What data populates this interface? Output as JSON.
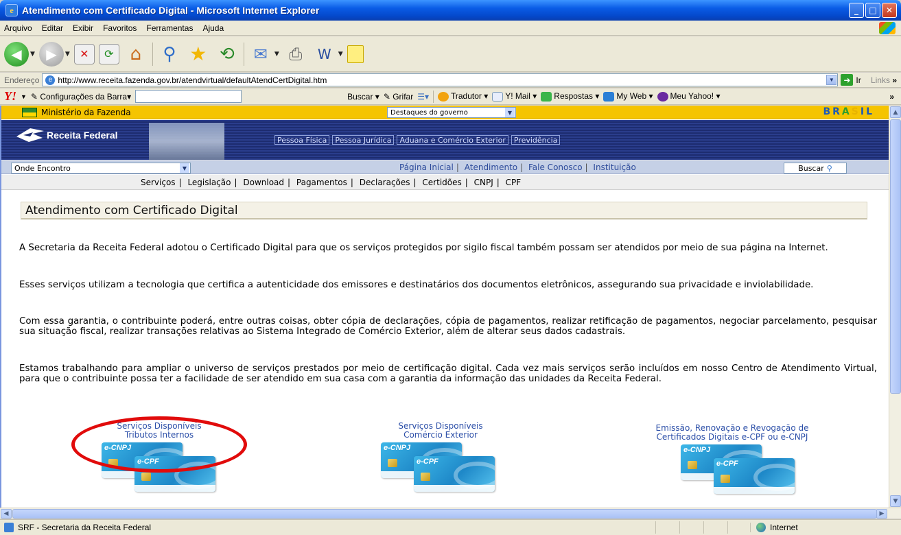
{
  "window": {
    "title": "Atendimento com Certificado Digital - Microsoft Internet Explorer",
    "icon": "ie-icon"
  },
  "menu": [
    "Arquivo",
    "Editar",
    "Exibir",
    "Favoritos",
    "Ferramentas",
    "Ajuda"
  ],
  "address": {
    "label": "Endereço",
    "url": "http://www.receita.fazenda.gov.br/atendvirtual/defaultAtendCertDigital.htm",
    "go_label": "Ir",
    "links_label": "Links"
  },
  "yahoo_toolbar": {
    "config_label": "Configurações da Barra",
    "search_btn": "Buscar",
    "grifar": "Grifar",
    "tradutor": "Tradutor",
    "ymail": "Y! Mail",
    "respostas": "Respostas",
    "myweb": "My Web",
    "meuyahoo": "Meu Yahoo!"
  },
  "gov_bar": {
    "ministerio": "Ministério da Fazenda",
    "destaques": "Destaques do governo",
    "brasil_logo": "BRASIL"
  },
  "header": {
    "logo_text": "Receita Federal",
    "nav": [
      "Pessoa Física",
      "Pessoa Jurídica",
      "Aduana e Comércio Exterior",
      "Previdência"
    ]
  },
  "sub_bar": {
    "onde_encontro": "Onde Encontro",
    "links": [
      "Página Inicial",
      "Atendimento",
      "Fale Conosco",
      "Instituição"
    ],
    "buscar": "Buscar"
  },
  "services_bar": [
    "Serviços",
    "Legislação",
    "Download",
    "Pagamentos",
    "Declarações",
    "Certidões",
    "CNPJ",
    "CPF"
  ],
  "page": {
    "title": "Atendimento com Certificado Digital",
    "paragraphs": [
      "A Secretaria da Receita Federal adotou o Certificado Digital para que os serviços protegidos por sigilo fiscal também possam ser atendidos por meio de sua página na Internet.",
      "Esses serviços utilizam a tecnologia que certifica a autenticidade dos emissores e destinatários dos documentos eletrônicos, assegurando sua privacidade e inviolabilidade.",
      "Com essa garantia, o contribuinte poderá, entre outras coisas, obter cópia de declarações, cópia de pagamentos, realizar retificação de pagamentos, negociar parcelamento, pesquisar sua situação fiscal, realizar transações relativas ao Sistema Integrado de Comércio Exterior, além de alterar seus dados cadastrais.",
      "Estamos trabalhando para ampliar o universo de serviços prestados por meio de certificação digital. Cada vez mais serviços serão incluídos em nosso Centro de Atendimento Virtual, para que o contribuinte possa ter a facilidade de ser atendido em sua casa com a garantia da informação das unidades da Receita Federal."
    ],
    "service_links": [
      {
        "line1": "Serviços Disponíveis",
        "line2": "Tributos Internos"
      },
      {
        "line1": "Serviços Disponíveis",
        "line2": "Comércio Exterior"
      },
      {
        "line1": "Emissão, Renovação e Revogação de",
        "line2": "Certificados Digitais e-CPF ou e-CNPJ"
      }
    ],
    "card_labels": {
      "cnpj": "e-CNPJ",
      "cpf": "e-CPF"
    }
  },
  "status": {
    "text": "SRF - Secretaria da Receita Federal",
    "zone": "Internet"
  }
}
